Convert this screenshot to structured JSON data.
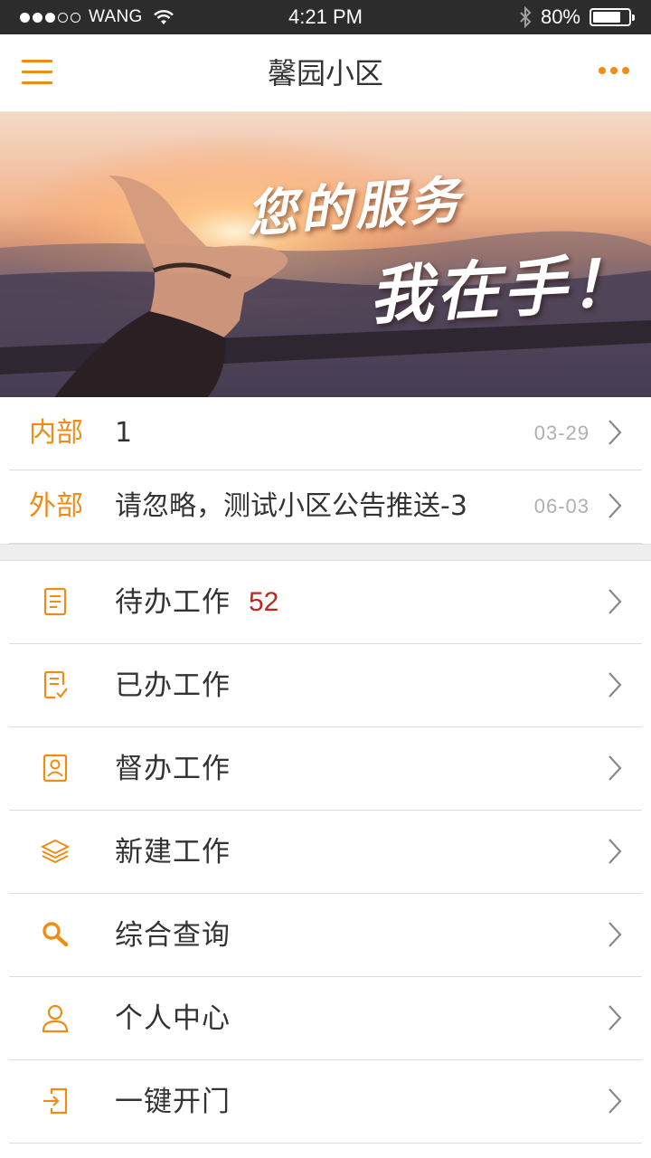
{
  "status_bar": {
    "carrier": "WANG",
    "time": "4:21 PM",
    "battery_percent_text": "80%",
    "battery_level": 0.8,
    "signal_filled": 3,
    "signal_total": 5
  },
  "nav": {
    "title": "馨园小区",
    "menu_icon": "hamburger-menu-icon",
    "more_icon": "more-dots-icon"
  },
  "banner": {
    "slogan_line1": "您的服务",
    "slogan_line2": "我在手！"
  },
  "notices": [
    {
      "tag": "内部",
      "text": "1",
      "date": "03-29"
    },
    {
      "tag": "外部",
      "text": "请忽略，测试小区公告推送-3",
      "date": "06-03"
    }
  ],
  "menu": [
    {
      "label": "待办工作",
      "badge": "52",
      "icon": "document-icon"
    },
    {
      "label": "已办工作",
      "badge": "",
      "icon": "document-check-icon"
    },
    {
      "label": "督办工作",
      "badge": "",
      "icon": "profile-card-icon"
    },
    {
      "label": "新建工作",
      "badge": "",
      "icon": "layers-icon"
    },
    {
      "label": "综合查询",
      "badge": "",
      "icon": "search-icon"
    },
    {
      "label": "个人中心",
      "badge": "",
      "icon": "user-icon"
    },
    {
      "label": "一键开门",
      "badge": "",
      "icon": "door-enter-icon"
    }
  ],
  "colors": {
    "accent": "#f08c14",
    "badge": "#c0261c",
    "status_bar_bg": "#2c2c2c"
  }
}
